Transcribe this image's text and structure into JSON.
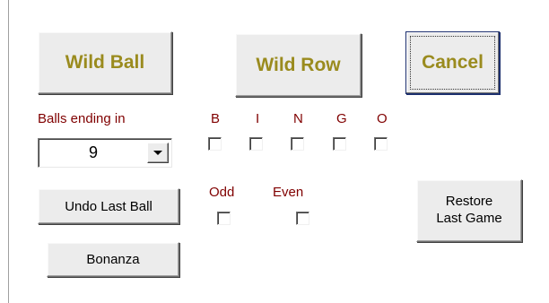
{
  "buttons": {
    "wild_ball": "Wild Ball",
    "wild_row": "Wild Row",
    "cancel": "Cancel",
    "undo_last_ball": "Undo Last Ball",
    "bonanza": "Bonanza",
    "restore_line1": "Restore",
    "restore_line2": "Last Game"
  },
  "balls_ending": {
    "label": "Balls ending in",
    "selected": "9"
  },
  "bingo_letters": [
    "B",
    "I",
    "N",
    "G",
    "O"
  ],
  "parity": {
    "odd": "Odd",
    "even": "Even"
  },
  "colors": {
    "big_button_text": "#9a8b1e",
    "label_red": "#800000"
  }
}
